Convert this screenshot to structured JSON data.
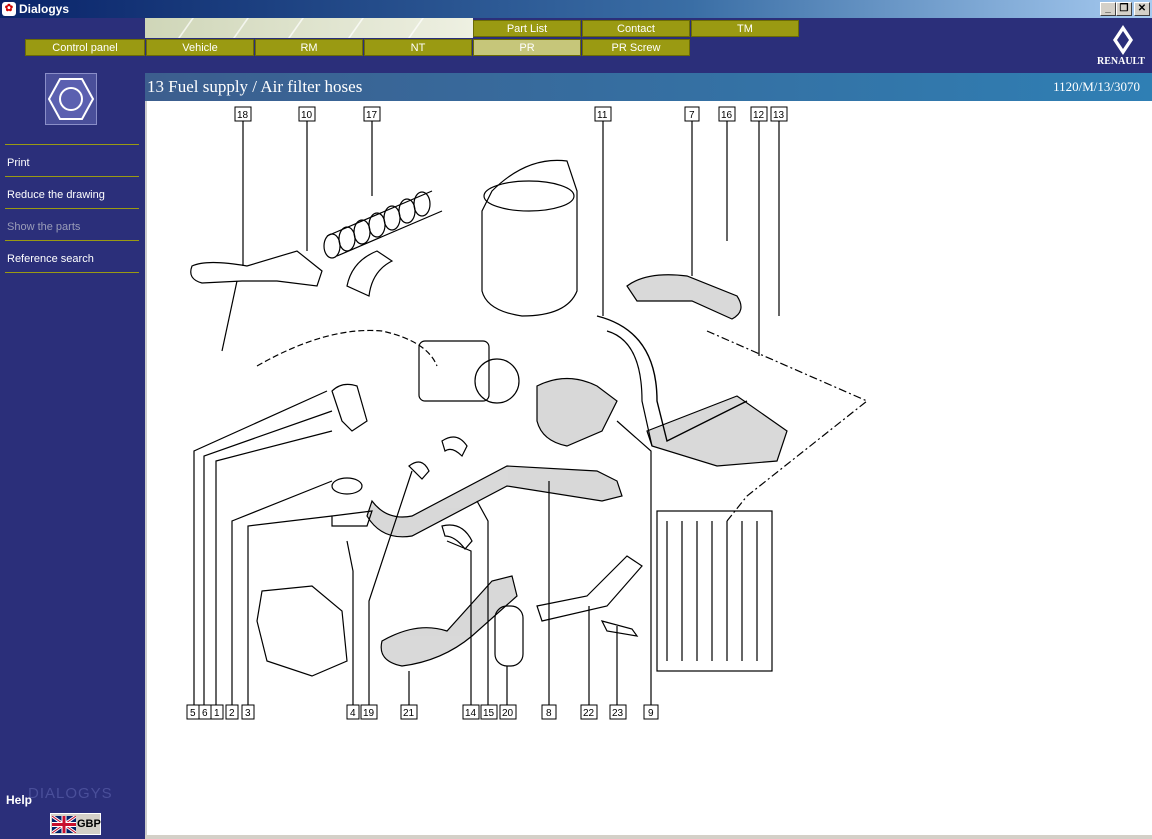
{
  "window": {
    "title": "Dialogys",
    "controls": {
      "minimize": "_",
      "maximize": "❐",
      "close": "✕"
    }
  },
  "nav": {
    "top_row": [
      "Part List",
      "Contact",
      "TM"
    ],
    "bottom_row": [
      "Control panel",
      "Vehicle",
      "RM",
      "NT",
      "PR",
      "PR Screw"
    ],
    "active": "PR"
  },
  "brand": {
    "name": "RENAULT"
  },
  "sidebar": {
    "menu": [
      {
        "label": "Print",
        "enabled": true
      },
      {
        "label": "Reduce the drawing",
        "enabled": true
      },
      {
        "label": "Show the parts",
        "enabled": false
      },
      {
        "label": "Reference search",
        "enabled": true
      }
    ],
    "help": "Help",
    "logo_text": "DIALOGYS",
    "language_code": "GBP"
  },
  "page": {
    "title": "13 Fuel supply / Air filter hoses",
    "reference": "1120/M/13/3070"
  },
  "drawing": {
    "top_labels": [
      "18",
      "10",
      "17",
      "11",
      "7",
      "16",
      "12",
      "13"
    ],
    "bottom_labels": [
      "5",
      "6",
      "1",
      "2",
      "3",
      "4",
      "19",
      "21",
      "14",
      "15",
      "20",
      "8",
      "22",
      "23",
      "9"
    ]
  },
  "colors": {
    "background": "#2b2f7a",
    "nav_button": "#9a9a12",
    "nav_active": "#c6c67a",
    "header_bar": "#2f7fb4"
  },
  "icons": {
    "app": "dialogys-app-icon",
    "hex": "hex-nut-icon",
    "flag": "uk-flag-icon",
    "brand": "renault-diamond-icon"
  }
}
